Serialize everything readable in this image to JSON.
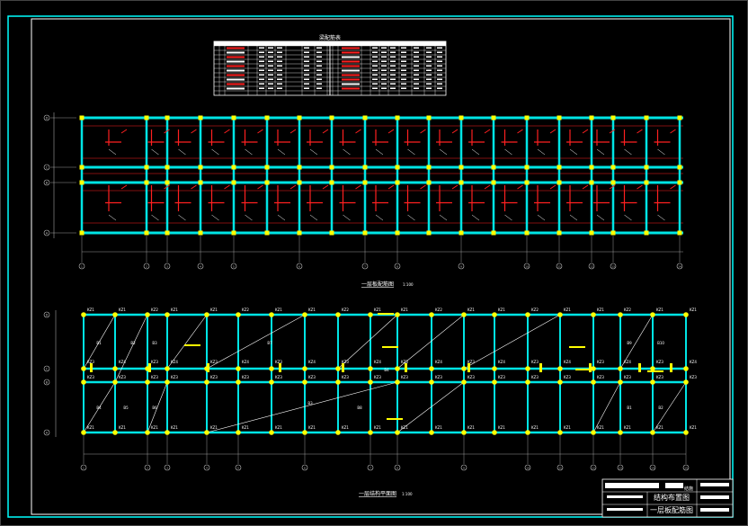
{
  "drawing": {
    "table_title": "梁配筋表",
    "plan1_title": "一层板配筋图",
    "plan1_scale": "1:100",
    "plan2_title": "一层结构平面图",
    "plan2_scale": "1:100",
    "column_label": "KZ1",
    "column_label_2": "KZ2",
    "column_label_3": "KZ3",
    "column_label_4": "KZ4",
    "slab_labels": [
      "B1",
      "B2",
      "B3",
      "B4",
      "B5",
      "B6",
      "B7",
      "B8",
      "B9",
      "B10"
    ],
    "axis_row_labels": [
      "A",
      "B",
      "C",
      "D"
    ],
    "axis_col_labels": [
      "1",
      "2",
      "3",
      "4",
      "5",
      "6",
      "7",
      "8",
      "9",
      "10",
      "11",
      "12",
      "13",
      "14",
      "15"
    ]
  },
  "title_block": {
    "drawing_name_1": "结构布置图",
    "drawing_name_2": "一层板配筋图",
    "sheet_code": "结施"
  },
  "colors": {
    "frame": "#00ffff",
    "beam": "#00e5e5",
    "rebar": "#ff2020",
    "column": "#ffff00",
    "text": "#ffffff",
    "dim": "#c0c0c0",
    "grid_bg": "#000000"
  }
}
